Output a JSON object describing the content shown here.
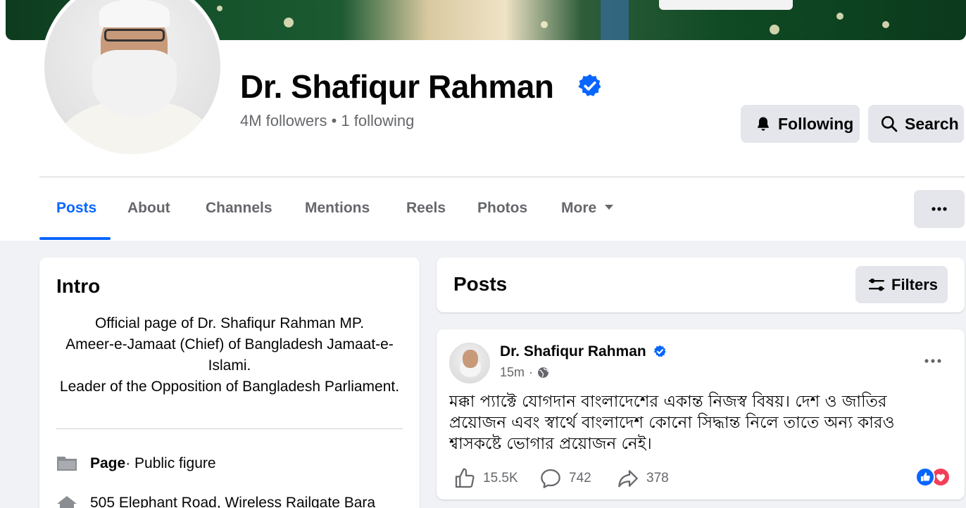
{
  "profile": {
    "name": "Dr. Shafiqur Rahman",
    "followers": "4M followers • 1 following"
  },
  "actions": {
    "following_label": "Following",
    "search_label": "Search"
  },
  "tabs": [
    {
      "label": "Posts",
      "active": true
    },
    {
      "label": "About"
    },
    {
      "label": "Channels"
    },
    {
      "label": "Mentions"
    },
    {
      "label": "Reels"
    },
    {
      "label": "Photos"
    },
    {
      "label": "More"
    }
  ],
  "intro": {
    "title": "Intro",
    "bio": [
      "Official page of Dr. Shafiqur Rahman MP.",
      "Ameer-e-Jamaat (Chief) of Bangladesh Jamaat-e-Islami.",
      "Leader of the Opposition of Bangladesh Parliament."
    ],
    "category_bold": "Page",
    "category_rest": " · Public figure",
    "address": "505 Elephant Road, Wireless Railgate Bara"
  },
  "posts_section": {
    "title": "Posts",
    "filters_label": "Filters"
  },
  "post": {
    "author": "Dr. Shafiqur Rahman",
    "time": "15m",
    "text": "মক্কা প্যাক্টে যোগদান বাংলাদেশের একান্ত নিজস্ব বিষয়। দেশ ও জাতির প্রয়োজন এবং স্বার্থে বাংলাদেশ কোনো সিদ্ধান্ত নিলে তাতে অন্য কারও শ্বাসকষ্টে ভোগার প্রয়োজন নেই।",
    "likes": "15.5K",
    "comments": "742",
    "shares": "378"
  },
  "colors": {
    "accent": "#0866ff",
    "verified": "#0866ff",
    "secondary_text": "#65676b",
    "button_bg": "#e4e6eb",
    "page_bg": "#f0f2f5",
    "love_reaction": "#f33e58"
  },
  "icons": [
    "verified-badge-icon",
    "bell-icon",
    "search-icon",
    "dropdown-arrow-icon",
    "more-dots-icon",
    "filters-icon",
    "page-flag-icon",
    "home-icon",
    "globe-icon",
    "like-icon",
    "comment-icon",
    "share-icon",
    "like-reaction-icon",
    "love-reaction-icon"
  ]
}
